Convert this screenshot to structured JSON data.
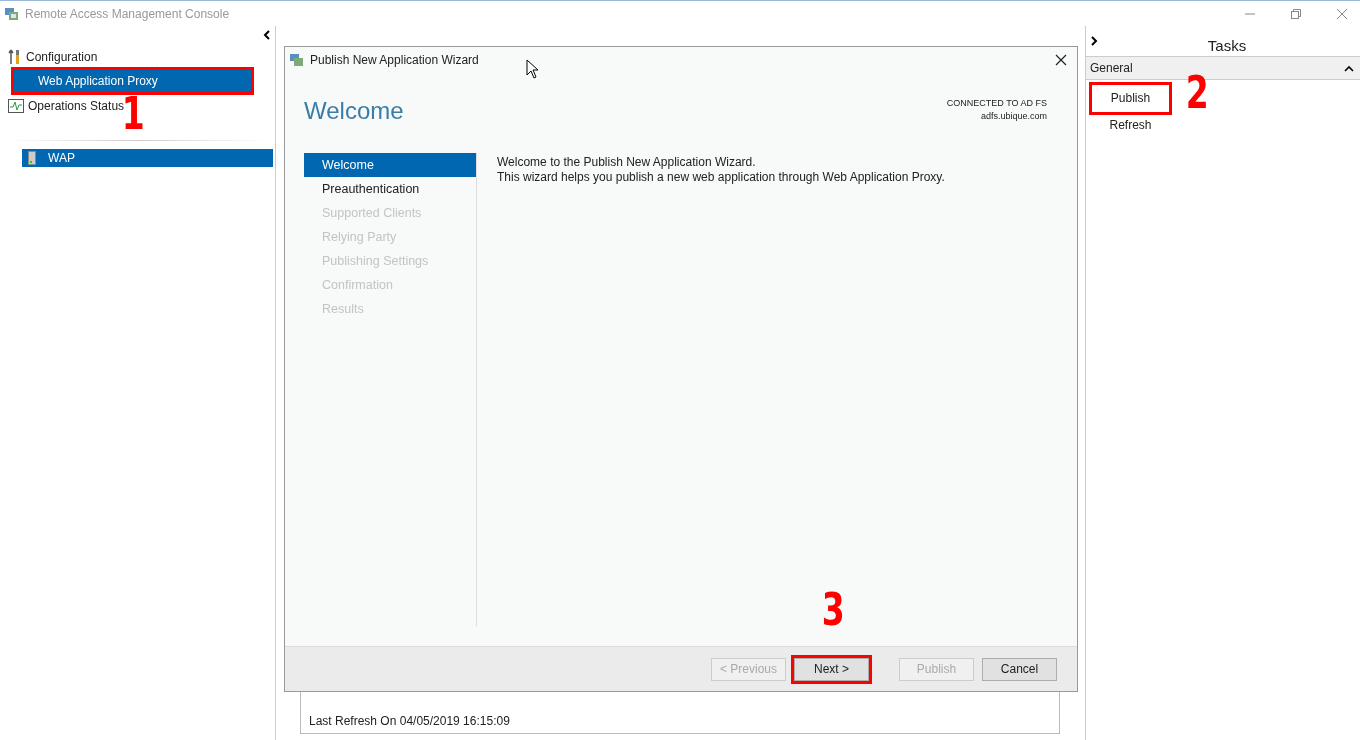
{
  "window": {
    "title": "Remote Access Management Console"
  },
  "navigation": {
    "items": [
      {
        "label": "Configuration",
        "kind": "settings",
        "children": [
          {
            "label": "Web Application Proxy",
            "selected": true,
            "highlighted": true,
            "callout": "1"
          }
        ]
      },
      {
        "label": "Operations Status",
        "kind": "monitor"
      }
    ],
    "servers": [
      {
        "label": "WAP",
        "selected": true
      }
    ]
  },
  "status": {
    "text": "Last Refresh On 04/05/2019 16:15:09"
  },
  "wizard": {
    "title": "Publish New Application Wizard",
    "heading": "Welcome",
    "connection": [
      "CONNECTED TO AD FS",
      "adfs.ubique.com"
    ],
    "steps": [
      {
        "label": "Welcome",
        "selected": true,
        "disabled": false
      },
      {
        "label": "Preauthentication",
        "selected": false,
        "disabled": false
      },
      {
        "label": "Supported Clients",
        "selected": false,
        "disabled": true
      },
      {
        "label": "Relying Party",
        "selected": false,
        "disabled": true
      },
      {
        "label": "Publishing Settings",
        "selected": false,
        "disabled": true
      },
      {
        "label": "Confirmation",
        "selected": false,
        "disabled": true
      },
      {
        "label": "Results",
        "selected": false,
        "disabled": true
      }
    ],
    "message": [
      "Welcome to the Publish New Application Wizard.",
      "This wizard helps you publish a new web application through Web Application Proxy."
    ],
    "buttons": [
      {
        "label": "< Previous",
        "disabled": true,
        "highlighted": false
      },
      {
        "label": "Next >",
        "disabled": false,
        "highlighted": true,
        "callout": "3"
      },
      {
        "label": "Publish",
        "disabled": true,
        "highlighted": false
      },
      {
        "label": "Cancel",
        "disabled": false,
        "highlighted": false
      }
    ]
  },
  "tasks": {
    "title": "Tasks",
    "section": {
      "label": "General",
      "expanded": true
    },
    "items": [
      {
        "label": "Publish",
        "highlighted": true,
        "callout": "2"
      },
      {
        "label": "Refresh",
        "highlighted": false
      }
    ]
  }
}
